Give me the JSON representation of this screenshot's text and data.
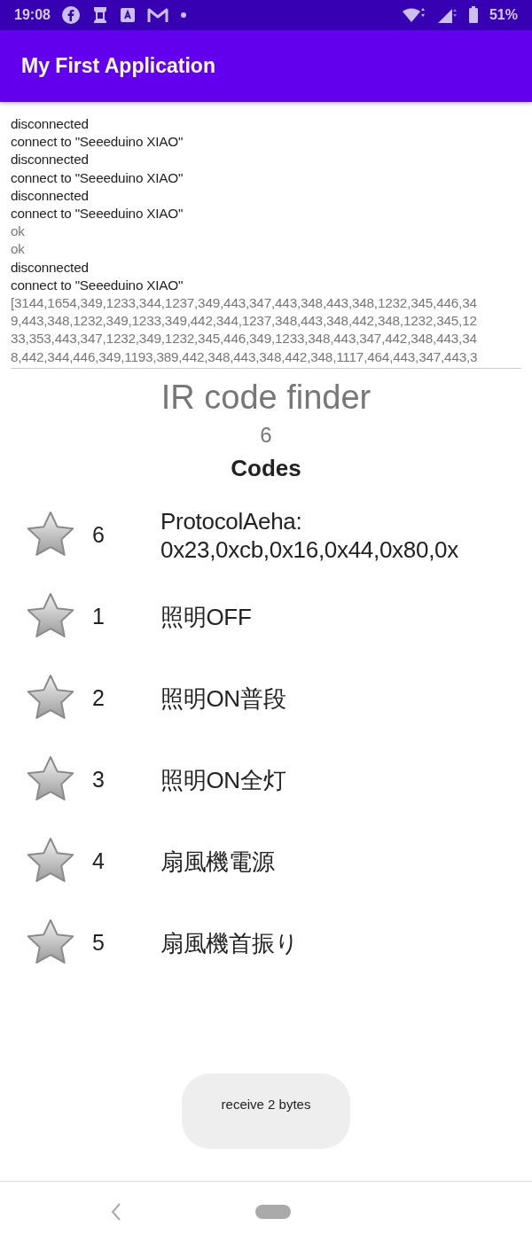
{
  "status_bar": {
    "time": "19:08",
    "battery": "51%"
  },
  "app_bar": {
    "title": "My First Application"
  },
  "log": [
    {
      "text": "disconnected",
      "kind": "event"
    },
    {
      "text": "connect to \"Seeeduino XIAO\"",
      "kind": "event"
    },
    {
      "text": "disconnected",
      "kind": "event"
    },
    {
      "text": "connect to \"Seeeduino XIAO\"",
      "kind": "event"
    },
    {
      "text": "disconnected",
      "kind": "event"
    },
    {
      "text": "connect to \"Seeeduino XIAO\"",
      "kind": "event"
    },
    {
      "text": "ok",
      "kind": "reply"
    },
    {
      "text": "ok",
      "kind": "reply"
    },
    {
      "text": "disconnected",
      "kind": "event"
    },
    {
      "text": "connect to \"Seeeduino XIAO\"",
      "kind": "event"
    },
    {
      "text": "[3144,1654,349,1233,344,1237,349,443,347,443,348,443,348,1232,345,446,34",
      "kind": "reply"
    },
    {
      "text": "9,443,348,1232,349,1233,349,442,344,1237,348,443,348,442,348,1232,345,12",
      "kind": "reply"
    },
    {
      "text": "33,353,443,347,1232,349,1232,345,446,349,1233,348,443,347,442,348,443,34",
      "kind": "reply"
    },
    {
      "text": "8,442,344,446,349,1193,389,442,348,443,348,442,348,1117,464,443,347,443,3",
      "kind": "reply"
    }
  ],
  "heading": "IR code finder",
  "count": "6",
  "codes_title": "Codes",
  "codes": [
    {
      "number": "6",
      "label": "ProtocolAeha:\n0x23,0xcb,0x16,0x44,0x80,0x"
    },
    {
      "number": "1",
      "label": "照明OFF"
    },
    {
      "number": "2",
      "label": "照明ON普段"
    },
    {
      "number": "3",
      "label": "照明ON全灯"
    },
    {
      "number": "4",
      "label": "扇風機電源"
    },
    {
      "number": "5",
      "label": "扇風機首振り"
    }
  ],
  "toast": "receive 2 bytes"
}
